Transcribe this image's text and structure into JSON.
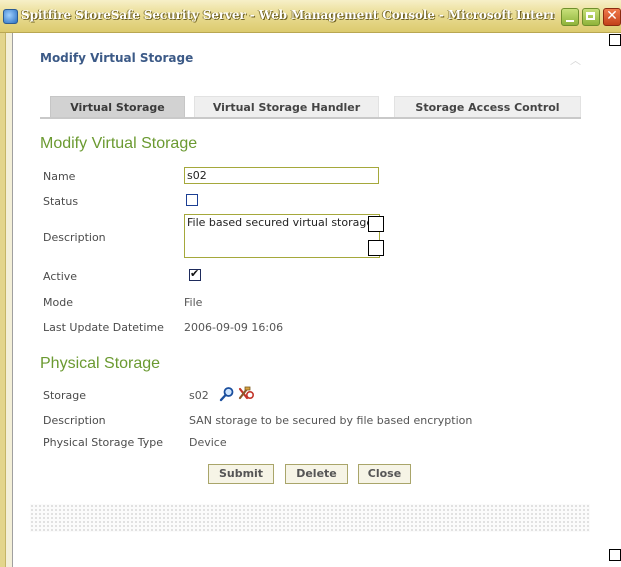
{
  "window": {
    "title": "Spitfire StoreSafe Security Server - Web Management Console - Microsoft Internet ...",
    "controls": [
      "minimize",
      "maximize",
      "close"
    ],
    "close_glyph": "✕"
  },
  "panel": {
    "title": "Modify Virtual Storage",
    "tabs": [
      {
        "label": "Virtual Storage",
        "active": true
      },
      {
        "label": "Virtual Storage Handler",
        "active": false
      },
      {
        "label": "Storage Access Control",
        "active": false
      }
    ]
  },
  "virtual_storage": {
    "section_title": "Modify Virtual Storage",
    "name_label": "Name",
    "name_value": "s02",
    "status_label": "Status",
    "status_checked": false,
    "description_label": "Description",
    "description_value": "File based secured virtual storage",
    "active_label": "Active",
    "active_checked": true,
    "mode_label": "Mode",
    "mode_value": "File",
    "last_update_label": "Last Update Datetime",
    "last_update_value": "2006-09-09 16:06"
  },
  "physical_storage": {
    "section_title": "Physical Storage",
    "storage_label": "Storage",
    "storage_value": "s02",
    "storage_icons": [
      "magnifier-icon",
      "tools-icon"
    ],
    "description_label": "Description",
    "description_value": "SAN storage to be secured by file based encryption",
    "type_label": "Physical Storage Type",
    "type_value": "Device"
  },
  "actions": {
    "submit": "Submit",
    "delete": "Delete",
    "close": "Close"
  },
  "colors": {
    "section_title": "#6b9a31",
    "panel_title": "#3c5a87",
    "input_border": "#a5a83b",
    "button_bg": "#f6f4e6"
  }
}
